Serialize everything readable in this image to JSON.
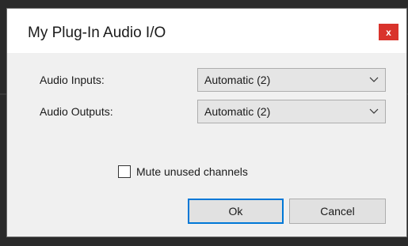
{
  "dialog": {
    "title": "My Plug-In Audio I/O",
    "close_glyph": "x",
    "close_icon": "close-icon"
  },
  "audio_inputs": {
    "label": "Audio Inputs:",
    "value": "Automatic (2)",
    "icon": "chevron-down-icon"
  },
  "audio_outputs": {
    "label": "Audio Outputs:",
    "value": "Automatic (2)",
    "icon": "chevron-down-icon"
  },
  "mute_unused": {
    "label": "Mute unused channels",
    "checked": false
  },
  "buttons": {
    "ok": "Ok",
    "cancel": "Cancel"
  },
  "colors": {
    "close_button": "#d9332c",
    "default_button_border": "#0078d7",
    "dialog_background": "#f0f0f0",
    "title_background": "#ffffff"
  }
}
